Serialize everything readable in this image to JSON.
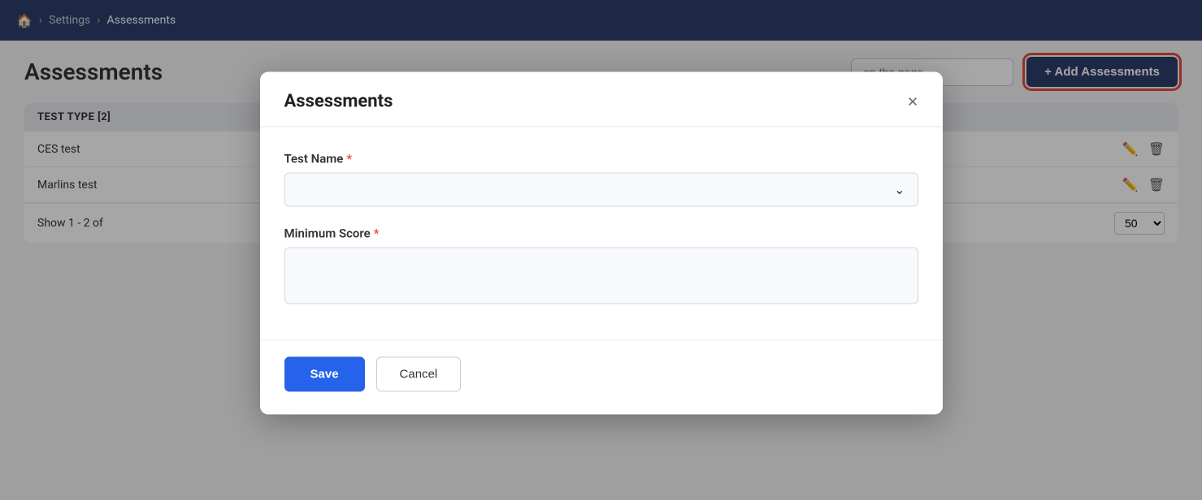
{
  "nav": {
    "home_icon": "🏠",
    "separator": "›",
    "items": [
      {
        "label": "Home",
        "active": false
      },
      {
        "label": "Settings",
        "active": false
      },
      {
        "label": "Assessments",
        "active": true
      }
    ]
  },
  "page": {
    "title": "Assessments",
    "search_placeholder": "on the page",
    "add_button_label": "+ Add Assessments"
  },
  "table": {
    "header": "TEST TYPE [2]",
    "rows": [
      {
        "name": "CES test"
      },
      {
        "name": "Marlins test"
      }
    ],
    "footer_text": "Show 1 - 2 of",
    "show_count": "50"
  },
  "modal": {
    "title": "Assessments",
    "close_label": "×",
    "test_name_label": "Test Name",
    "test_name_required": "*",
    "test_name_placeholder": "",
    "minimum_score_label": "Minimum Score",
    "minimum_score_required": "*",
    "minimum_score_placeholder": "",
    "save_label": "Save",
    "cancel_label": "Cancel",
    "chevron": "⌄"
  }
}
